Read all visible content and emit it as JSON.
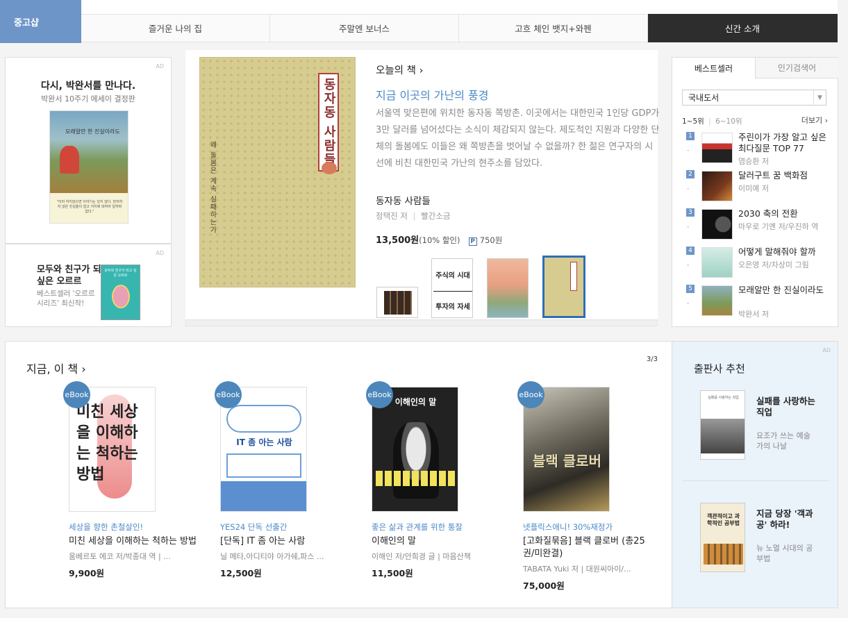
{
  "top_tabs": {
    "shop_label": "중고샵",
    "tabs": [
      {
        "label": "즐거운 나의 집"
      },
      {
        "label": "주말엔 보너스"
      },
      {
        "label": "고흐 체인 뱃지+와펜"
      },
      {
        "label": "신간 소개"
      }
    ]
  },
  "left_ads": [
    {
      "title": "다시, 박완서를 만나다.",
      "subtitle": "박완서 10주기 에세이 결정판",
      "ad_mark": "AD",
      "cover_text": "모래알만 한 진실이라도",
      "cover_quote": "\"이미 하지않으면 이야기는 있지 않다. 먼저하지 않은 진실들이 알고 지지에 대하여 일하며 없다.\""
    },
    {
      "title": "모두와 친구가 되고 싶은 오르르",
      "subtitle": "베스트셀러 '오르르 시리즈' 최신작!",
      "ad_mark": "AD",
      "cover_text": "모두와 친구가 되고 싶은 오르르"
    }
  ],
  "today": {
    "heading": "오늘의 책 ›",
    "headline": "지금 이곳의 가난의 풍경",
    "description": "서울역 맞은편에 위치한 동자동 쪽방촌. 이곳에서는 대한민국 1인당 GDP가 3만 달러를 넘어섰다는 소식이 체감되지 않는다. 제도적인 지원과 다양한 단체의 돌봄에도 이들은 왜 쪽방촌을 벗어날 수 없을까? 한 젊은 연구자의 시선에 비친 대한민국 가난의 현주소를 담았다.",
    "book_title": "동자동 사람들",
    "author": "정택진 저",
    "publisher": "빨간소금",
    "price": "13,500원",
    "discount": "(10% 할인)",
    "point_icon": "P",
    "points": "750원",
    "cover_title": "동자동 사람들",
    "cover_subtitle": "왜 돌봄은 계속 실패하는가",
    "thumb_titles": [
      "",
      "주식의 시대 투자의 자세",
      "",
      "동자동 사람들"
    ]
  },
  "bestseller": {
    "tabs": [
      "베스트셀러",
      "인기검색어"
    ],
    "category": "국내도서",
    "range_active": "1~5위",
    "range_inactive": "6~10위",
    "more": "더보기 ›",
    "items": [
      {
        "rank": "1",
        "title": "주린이가 가장 알고 싶은 최다질문 TOP 77",
        "author": "염승환 저"
      },
      {
        "rank": "2",
        "title": "달러구트 꿈 백화점",
        "author": "이미예 저"
      },
      {
        "rank": "3",
        "title": "2030 축의 전환",
        "author": "마우로 기옌 저/우진하 역"
      },
      {
        "rank": "4",
        "title": "어떻게 말해줘야 할까",
        "author": "오은영 저/차상미 그림"
      },
      {
        "rank": "5",
        "title": "모래알만 한 진실이라도",
        "author": "박완서 저"
      }
    ]
  },
  "now_books": {
    "heading": "지금, 이 책 ›",
    "page": "3/3",
    "badge": "eBook",
    "books": [
      {
        "tag": "세상을 향한 촌철살인!",
        "title": "미친 세상을 이해하는 척하는 방법",
        "author": "움베르토 에코 저/박종대 역 | ...",
        "price": "9,900원",
        "cover_text": "미친 세상을 이해하는 척하는 방법"
      },
      {
        "tag": "YES24 단독 선출간",
        "title": "[단독] IT 좀 아는 사람",
        "author": "닐 메타,아디티야 아가쉐,파스 ...",
        "price": "12,500원",
        "cover_text": "IT 좀 아는 사람"
      },
      {
        "tag": "좋은 삶과 관계를 위한 통찰",
        "title": "이해인의 말",
        "author": "이해인 저/안희경 글 | 마음산책",
        "price": "11,500원",
        "cover_text": "이해인의 말"
      },
      {
        "tag": "넷플릭스애니! 30%재정가",
        "title": "[고화질묶음] 블랙 클로버 (총25권/미완결)",
        "author": "TABATA Yuki 저 | 대원씨아이/...",
        "price": "75,000원",
        "cover_text": "블랙 클로버"
      }
    ]
  },
  "publisher": {
    "heading": "출판사 추천",
    "ad_mark": "AD",
    "cards": [
      {
        "title": "실패를 사랑하는 직업",
        "subtitle": "요조가 쓰는 예술가의 나날",
        "cover_text": "실패를 사랑하는 직업"
      },
      {
        "title": "지금 당장 '객과공' 하라!",
        "subtitle": "뉴 노멀 시대의 공부법",
        "cover_text": "객관적이고 과학적인 공부법"
      }
    ]
  }
}
